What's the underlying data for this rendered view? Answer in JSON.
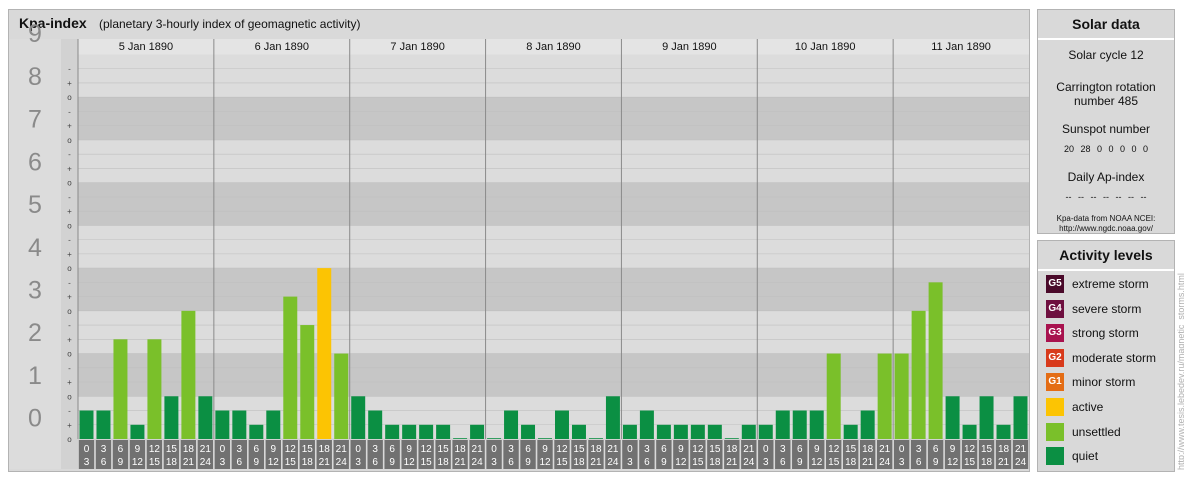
{
  "header": {
    "title": "Kpa-index",
    "subtitle": "(planetary 3-hourly index of geomagnetic activity)"
  },
  "chart_data": {
    "type": "bar",
    "ylim": [
      0,
      9
    ],
    "y_ticks": [
      "0",
      "1",
      "2",
      "3",
      "4",
      "5",
      "6",
      "7",
      "8",
      "9"
    ],
    "minor_ticks": [
      "o",
      "+",
      "-"
    ],
    "days": [
      "5 Jan 1890",
      "6 Jan 1890",
      "7 Jan 1890",
      "8 Jan 1890",
      "9 Jan 1890",
      "10 Jan 1890",
      "11 Jan 1890"
    ],
    "slots": [
      [
        "0",
        "3"
      ],
      [
        "3",
        "6"
      ],
      [
        "6",
        "9"
      ],
      [
        "9",
        "12"
      ],
      [
        "12",
        "15"
      ],
      [
        "15",
        "18"
      ],
      [
        "18",
        "21"
      ],
      [
        "21",
        "24"
      ]
    ],
    "values": [
      0.667,
      0.667,
      2.333,
      0.333,
      2.333,
      1.0,
      3.0,
      1.0,
      0.667,
      0.667,
      0.333,
      0.667,
      3.333,
      2.667,
      4.0,
      2.0,
      1.0,
      0.667,
      0.333,
      0.333,
      0.333,
      0.333,
      0.0,
      0.333,
      0.0,
      0.667,
      0.333,
      0.0,
      0.667,
      0.333,
      0.0,
      1.0,
      0.333,
      0.667,
      0.333,
      0.333,
      0.333,
      0.333,
      0.0,
      0.333,
      0.333,
      0.667,
      0.667,
      0.667,
      2.0,
      0.333,
      0.667,
      2.0,
      2.0,
      3.0,
      3.667,
      1.0,
      0.333,
      1.0,
      0.333,
      1.0
    ],
    "colors": {
      "quiet": "#0b8f43",
      "unsettled": "#7ac02a",
      "active": "#fcc403",
      "band_dark": "#c6c6c6",
      "band_light": "#dcdcdc",
      "slot_bg": "#717171"
    }
  },
  "solar": {
    "title": "Solar data",
    "cycle": "Solar cycle 12",
    "carrington_line1": "Carrington rotation",
    "carrington_line2": "number 485",
    "sunspot_label": "Sunspot number",
    "sunspots": [
      "20",
      "28",
      "0",
      "0",
      "0",
      "0",
      "0"
    ],
    "ap_label": "Daily Ap-index",
    "ap_values": [
      "--",
      "--",
      "--",
      "--",
      "--",
      "--",
      "--"
    ],
    "source_line1": "Kpa-data from NOAA NCEI:",
    "source_line2": "http://www.ngdc.noaa.gov/"
  },
  "levels": {
    "title": "Activity levels",
    "items": [
      {
        "badge": "G5",
        "label": "extreme storm",
        "color": "#4a0a2a"
      },
      {
        "badge": "G4",
        "label": "severe storm",
        "color": "#6e0f3f"
      },
      {
        "badge": "G3",
        "label": "strong storm",
        "color": "#a8124e"
      },
      {
        "badge": "G2",
        "label": "moderate storm",
        "color": "#d83a1b"
      },
      {
        "badge": "G1",
        "label": "minor storm",
        "color": "#e46d15"
      },
      {
        "badge": "",
        "label": "active",
        "color": "#fcc403"
      },
      {
        "badge": "",
        "label": "unsettled",
        "color": "#7ac02a"
      },
      {
        "badge": "",
        "label": "quiet",
        "color": "#0b8f43"
      }
    ]
  },
  "watermark": "http://www.tesis.lebedev.ru/magnetic_storms.html"
}
